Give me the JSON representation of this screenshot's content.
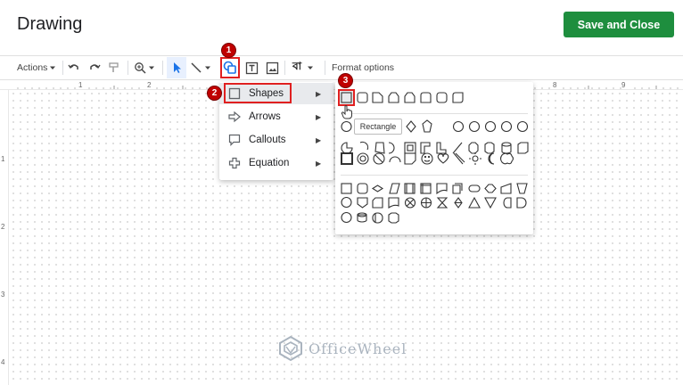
{
  "header": {
    "title": "Drawing",
    "save_label": "Save and Close"
  },
  "toolbar": {
    "actions_label": "Actions",
    "wordart_label": "বা",
    "format_options_label": "Format options"
  },
  "callouts": [
    "1",
    "2",
    "3"
  ],
  "ruler": {
    "top_numbers": [
      "1",
      "2",
      "8",
      "9"
    ],
    "left_numbers": [
      "1",
      "2",
      "3",
      "4"
    ]
  },
  "shape_menu": {
    "items": [
      {
        "label": "Shapes",
        "icon": "square-outline-icon"
      },
      {
        "label": "Arrows",
        "icon": "arrow-outline-icon"
      },
      {
        "label": "Callouts",
        "icon": "speech-bubble-icon"
      },
      {
        "label": "Equation",
        "icon": "plus-outline-icon"
      }
    ]
  },
  "shapes_panel": {
    "tooltip": "Rectangle"
  },
  "watermark": {
    "text": "OfficeWheel"
  },
  "colors": {
    "save_button": "#1e8e3e",
    "highlight": "#e02020",
    "badge": "#c00000",
    "selected_tool": "#1a73e8"
  }
}
